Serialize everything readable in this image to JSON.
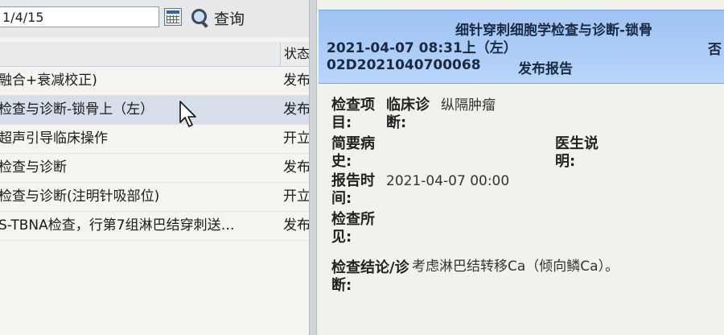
{
  "toolbar": {
    "date_value": "1/4/15",
    "search_label": "查询"
  },
  "list": {
    "status_header": "状态",
    "rows": [
      {
        "name": "融合+衰减校正)",
        "status": "发布"
      },
      {
        "name": "检查与诊断-锁骨上（左）",
        "status": "发布"
      },
      {
        "name": "超声引导临床操作",
        "status": "开立"
      },
      {
        "name": "检查与诊断",
        "status": "发布"
      },
      {
        "name": "检查与诊断(注明针吸部位)",
        "status": "开立"
      },
      {
        "name": "S-TBNA检查，行第7组淋巴结穿刺送…",
        "status": "发布"
      }
    ]
  },
  "report": {
    "title": "细针穿刺细胞学检查与诊断-锁骨",
    "datetime": "2021-04-07 08:31上（左）",
    "right_char": "否",
    "id": "02D2021040700068",
    "status": "发布报告",
    "labels": {
      "exam_item": "检查项目:",
      "clinical_diagnosis": "临床诊断:",
      "brief_history": "简要病史:",
      "doctor_note": "医生说明:",
      "report_time": "报告时间:",
      "findings": "检查所见:",
      "conclusion": "检查结论/诊断:"
    },
    "values": {
      "clinical_diagnosis": "纵隔肿瘤",
      "report_time": "2021-04-07 00:00",
      "conclusion": "考虑淋巴结转移Ca（倾向鳞Ca）。"
    }
  },
  "colors": {
    "header_band": "#a9cbf7",
    "selected_row": "#d6deea"
  }
}
